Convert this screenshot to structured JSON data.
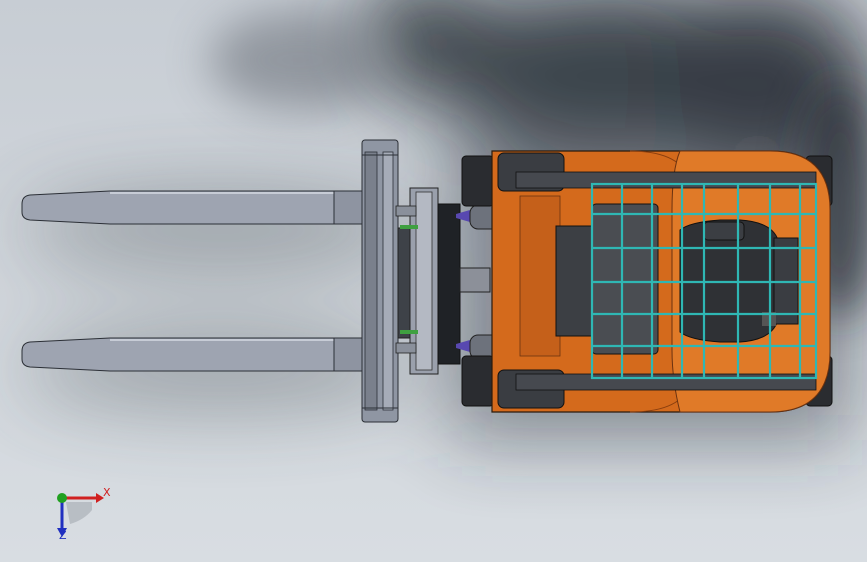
{
  "viewport": {
    "background": "#cfd4da",
    "shadow_color": "#1e232a"
  },
  "model": {
    "name": "forklift-top-view",
    "body_color": "#d46a1c",
    "fork_color": "#9aa0ad",
    "cage_color": "#2fb7b4",
    "seat_color": "#3a3a3a",
    "frame_color": "#4a4a4a"
  },
  "triad": {
    "x_label": "X",
    "z_label": "Z",
    "x_color": "#d02020",
    "y_color": "#20a020",
    "z_color": "#2030c0"
  }
}
